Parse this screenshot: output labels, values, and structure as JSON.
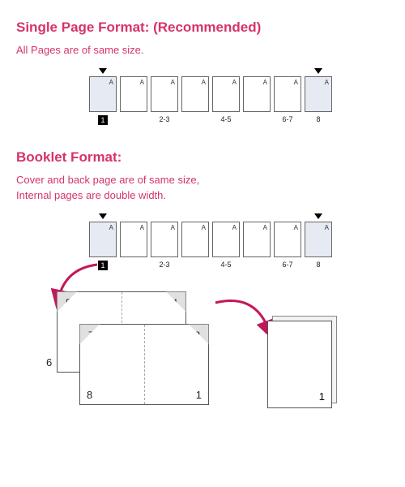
{
  "single": {
    "title": "Single Page Format: (Recommended)",
    "desc": "All Pages are of same size.",
    "pages": [
      {
        "letter": "A",
        "selected": true,
        "marker": true,
        "label": "1",
        "current": true
      },
      {
        "letter": "A",
        "selected": false,
        "marker": false,
        "label": ""
      },
      {
        "letter": "A",
        "selected": false,
        "marker": false,
        "label": "2-3"
      },
      {
        "letter": "A",
        "selected": false,
        "marker": false,
        "label": ""
      },
      {
        "letter": "A",
        "selected": false,
        "marker": false,
        "label": "4-5"
      },
      {
        "letter": "A",
        "selected": false,
        "marker": false,
        "label": ""
      },
      {
        "letter": "A",
        "selected": false,
        "marker": false,
        "label": "6-7"
      },
      {
        "letter": "A",
        "selected": true,
        "marker": true,
        "label": "8"
      }
    ]
  },
  "booklet": {
    "title": "Booklet Format:",
    "desc": "Cover and back page are of same size,\nInternal pages are double width.",
    "pages": [
      {
        "letter": "A",
        "selected": true,
        "marker": true,
        "label": "1",
        "current": true
      },
      {
        "letter": "A",
        "selected": false,
        "marker": false,
        "label": ""
      },
      {
        "letter": "A",
        "selected": false,
        "marker": false,
        "label": "2-3"
      },
      {
        "letter": "A",
        "selected": false,
        "marker": false,
        "label": ""
      },
      {
        "letter": "A",
        "selected": false,
        "marker": false,
        "label": "4-5"
      },
      {
        "letter": "A",
        "selected": false,
        "marker": false,
        "label": ""
      },
      {
        "letter": "A",
        "selected": false,
        "marker": false,
        "label": "6-7"
      },
      {
        "letter": "A",
        "selected": true,
        "marker": true,
        "label": "8"
      }
    ],
    "spread_top": {
      "fold_left": "5",
      "fold_right": "4",
      "bottom_left": "6"
    },
    "spread_bottom": {
      "fold_left": "7",
      "fold_right": "2",
      "bottom_left": "8",
      "bottom_right": "1"
    },
    "open_page": "1"
  }
}
